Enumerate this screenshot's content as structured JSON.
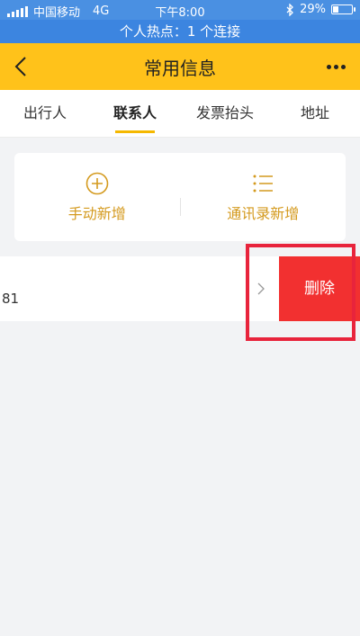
{
  "status_bar": {
    "carrier": "中国移动",
    "network": "4G",
    "time": "下午8:00",
    "battery": "29%",
    "battery_level": 0.29
  },
  "hotspot": {
    "text": "个人热点：1 个连接"
  },
  "nav": {
    "title": "常用信息"
  },
  "tabs": [
    {
      "label": "出行人",
      "active": false
    },
    {
      "label": "联系人",
      "active": true
    },
    {
      "label": "发票抬头",
      "active": false
    },
    {
      "label": "地址",
      "active": false
    }
  ],
  "add_options": {
    "manual": "手动新增",
    "contacts": "通讯录新增"
  },
  "contact": {
    "number": "81",
    "delete_label": "删除"
  },
  "colors": {
    "nav_yellow": "#ffc21a",
    "accent_gold": "#d49a1e",
    "delete_red": "#f23030",
    "status_blue": "#4a90e2"
  }
}
